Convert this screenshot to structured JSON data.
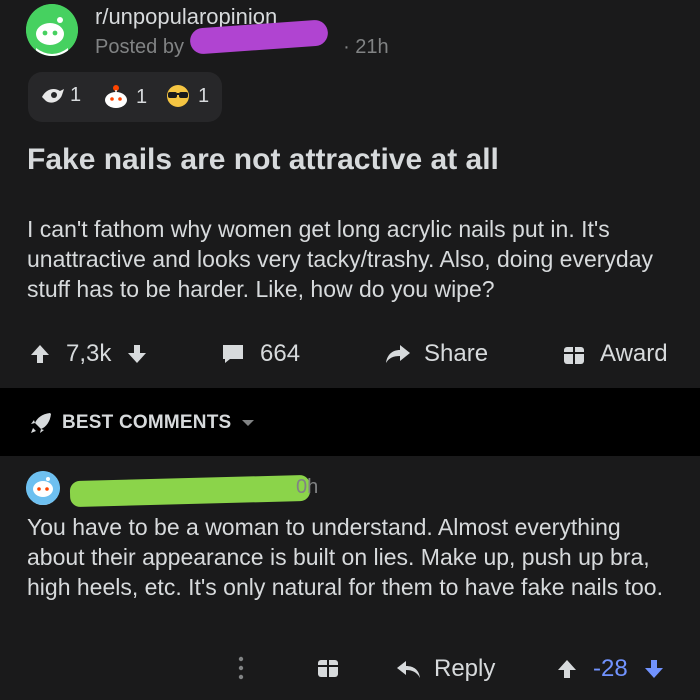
{
  "post": {
    "subreddit": "r/unpopularopinion",
    "posted_by_prefix": "Posted by",
    "age": "· 21h",
    "awards": [
      {
        "icon": "hand-award-icon",
        "count": "1"
      },
      {
        "icon": "snoo-award-icon",
        "count": "1"
      },
      {
        "icon": "sunglasses-award-icon",
        "count": "1"
      }
    ],
    "title": "Fake nails are not attractive at all",
    "body": "I can't fathom why women get long acrylic nails put in. It's unattractive and looks very tacky/trashy. Also, doing everyday stuff has to be harder. Like, how do you wipe?",
    "votes": "7,3k",
    "comments": "664",
    "share_label": "Share",
    "award_label": "Award"
  },
  "sort": {
    "label": "BEST COMMENTS"
  },
  "comment": {
    "age": "0h",
    "body": "You have to be a woman to understand. Almost everything about their appearance is built on lies. Make up, push up bra, high heels, etc. It's only natural for them to have fake nails too.",
    "reply_label": "Reply",
    "score": "-28",
    "score_color": "#7193ff"
  },
  "colors": {
    "background": "#000000",
    "card": "#1a1a1b",
    "text": "#d7dadc",
    "muted": "#818384",
    "redaction_user": "#b044d1",
    "redaction_commenter": "#8bd44a"
  }
}
